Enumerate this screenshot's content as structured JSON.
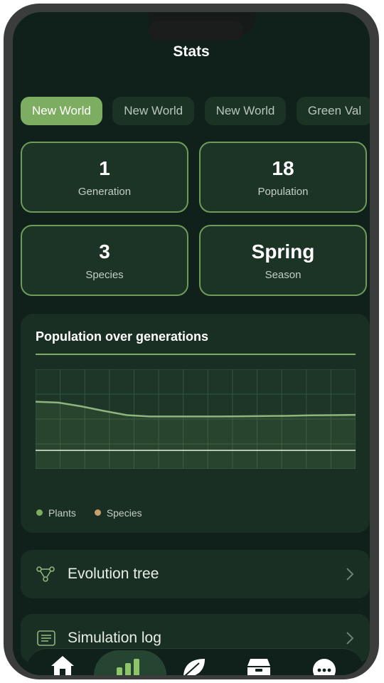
{
  "header": {
    "title": "Stats"
  },
  "tabs": [
    {
      "label": "New World",
      "active": true
    },
    {
      "label": "New World",
      "active": false
    },
    {
      "label": "New World",
      "active": false
    },
    {
      "label": "Green Val",
      "active": false
    }
  ],
  "stats": [
    {
      "value": "1",
      "label": "Generation"
    },
    {
      "value": "18",
      "label": "Population"
    },
    {
      "value": "3",
      "label": "Species"
    },
    {
      "value": "Spring",
      "label": "Season"
    }
  ],
  "chart": {
    "title": "Population over generations",
    "legend": [
      {
        "name": "Plants",
        "color": "#7dad60"
      },
      {
        "name": "Species",
        "color": "#c9a06b"
      }
    ]
  },
  "chart_data": {
    "type": "line",
    "title": "Population over generations",
    "xlabel": "",
    "ylabel": "",
    "grid": true,
    "series": [
      {
        "name": "Plants",
        "values": [
          24,
          23.6,
          22,
          20,
          18.2,
          17.6,
          17.6,
          17.6,
          17.6,
          17.7,
          17.8,
          17.9,
          18.1,
          18.2,
          18.3
        ]
      },
      {
        "name": "Species",
        "values": [
          3,
          3,
          3,
          3,
          3,
          3,
          3,
          3,
          3,
          3,
          3,
          3,
          3,
          3,
          3
        ]
      }
    ],
    "ylim": [
      -5,
      38
    ],
    "legend_position": "bottom-left"
  },
  "menu": [
    {
      "label": "Evolution tree",
      "icon": "evolution-tree-icon"
    },
    {
      "label": "Simulation log",
      "icon": "log-icon"
    }
  ],
  "nav": [
    {
      "icon": "home-icon",
      "active": false
    },
    {
      "icon": "stats-icon",
      "active": true
    },
    {
      "icon": "leaf-icon",
      "active": false
    },
    {
      "icon": "inventory-icon",
      "active": false
    },
    {
      "icon": "more-icon",
      "active": false
    }
  ]
}
